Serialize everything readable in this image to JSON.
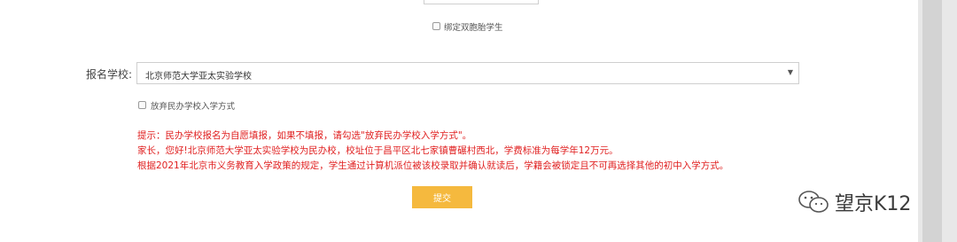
{
  "twins_option": {
    "label": "绑定双胞胎学生",
    "checked": false
  },
  "school_field": {
    "label": "报名学校:",
    "selected": "北京师范大学亚太实验学校"
  },
  "give_up_option": {
    "label": "放弃民办学校入学方式",
    "checked": false
  },
  "notices": [
    "提示：民办学校报名为自愿填报，如果不填报，请勾选\"放弃民办学校入学方式\"。",
    "家长，您好!北京师范大学亚太实验学校为民办校，校址位于昌平区北七家镇曹碾村西北，学费标准为每学年12万元。",
    "根据2021年北京市义务教育入学政策的规定，学生通过计算机派位被该校录取并确认就读后，学籍会被锁定且不可再选择其他的初中入学方式。"
  ],
  "submit": {
    "label": "提交"
  },
  "watermark": {
    "text": "望京K12",
    "icon": "wechat-icon"
  },
  "colors": {
    "notice": "#e02020",
    "button": "#f5b93e",
    "page": "#ffffff"
  }
}
